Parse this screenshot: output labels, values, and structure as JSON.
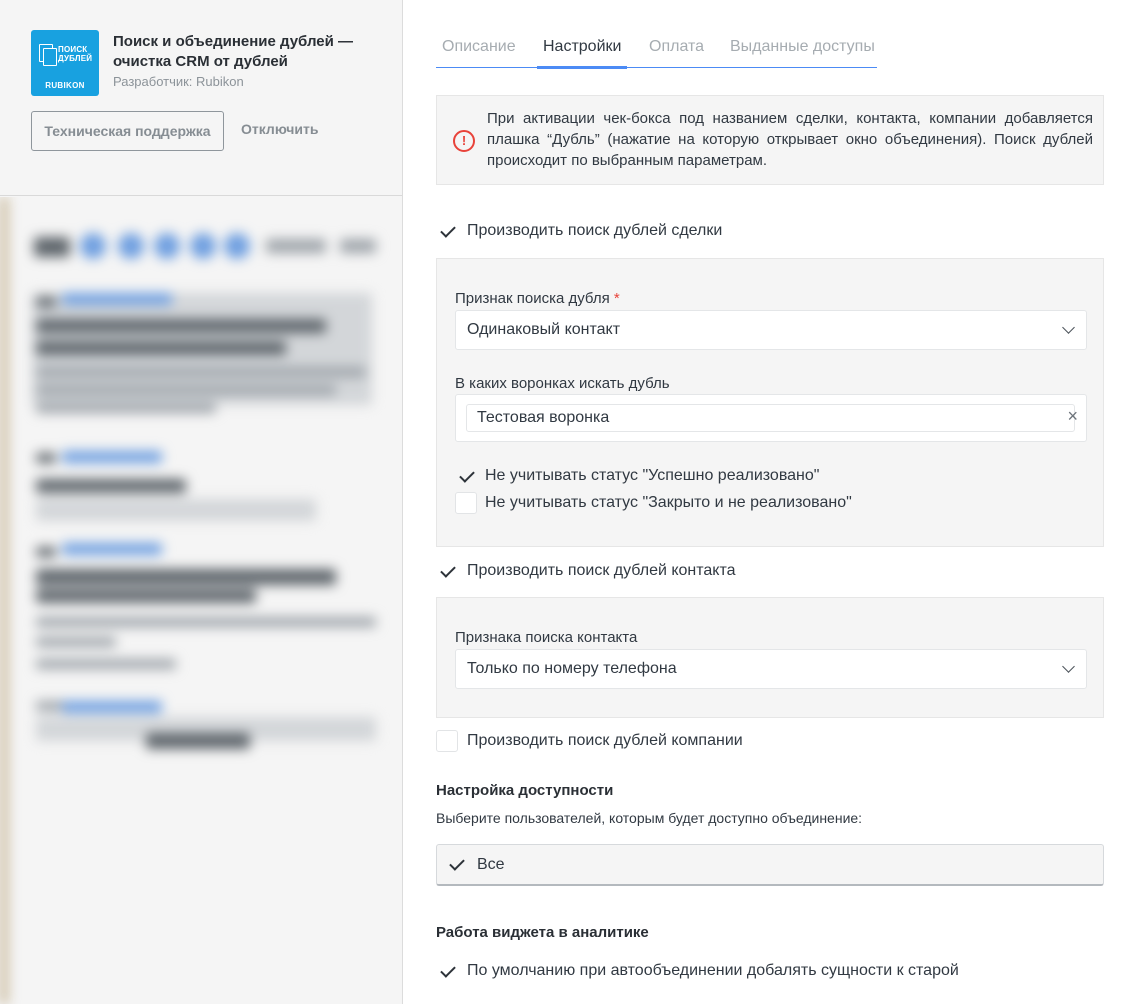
{
  "app": {
    "logo_line1": "ПОИСК",
    "logo_line2": "ДУБЛЕЙ",
    "logo_brand": "RUBIKON",
    "title": "Поиск и объединение дублей — очистка CRM от дублей",
    "developer": "Разработчик: Rubikon",
    "support_button": "Техническая поддержка",
    "disable_button": "Отключить"
  },
  "tabs": [
    {
      "label": "Описание",
      "active": false
    },
    {
      "label": "Настройки",
      "active": true
    },
    {
      "label": "Оплата",
      "active": false
    },
    {
      "label": "Выданные доступы",
      "active": false
    }
  ],
  "info": {
    "icon": "info-circle-icon",
    "text": "При активации чек-бокса под названием сделки, контакта, компании добавляется плашка “Дубль” (нажатие на которую открывает окно объединения). Поиск дублей происходит по выбранным параметрам."
  },
  "deals": {
    "checkbox_label": "Производить поиск дублей сделки",
    "checked": true,
    "sign_label": "Признак поиска дубля",
    "required_mark": "*",
    "sign_value": "Одинаковый контакт",
    "pipelines_label": "В каких воронках искать дубль",
    "pipeline_tag": "Тестовая воронка",
    "clear_symbol": "×",
    "ignore_success_label": "Не учитывать статус \"Успешно реализовано\"",
    "ignore_success_checked": true,
    "ignore_closed_label": "Не учитывать статус \"Закрыто и не реализовано\"",
    "ignore_closed_checked": false
  },
  "contacts": {
    "checkbox_label": "Производить поиск дублей контакта",
    "checked": true,
    "sign_label": "Признака поиска контакта",
    "sign_value": "Только по номеру телефона"
  },
  "companies": {
    "checkbox_label": "Производить поиск дублей компании",
    "checked": false
  },
  "access": {
    "title": "Настройка доступности",
    "subtitle": "Выберите пользователей, которым будет доступно объединение:",
    "all_label": "Все",
    "all_checked": true
  },
  "analytics": {
    "title": "Работа виджета в аналитике",
    "checkbox_label": "По умолчанию при автообъединении добалять сущности к старой",
    "checked": true
  },
  "colors": {
    "accent": "#4c8bf5",
    "logo_bg": "#18a1e0",
    "danger": "#e8433a"
  }
}
